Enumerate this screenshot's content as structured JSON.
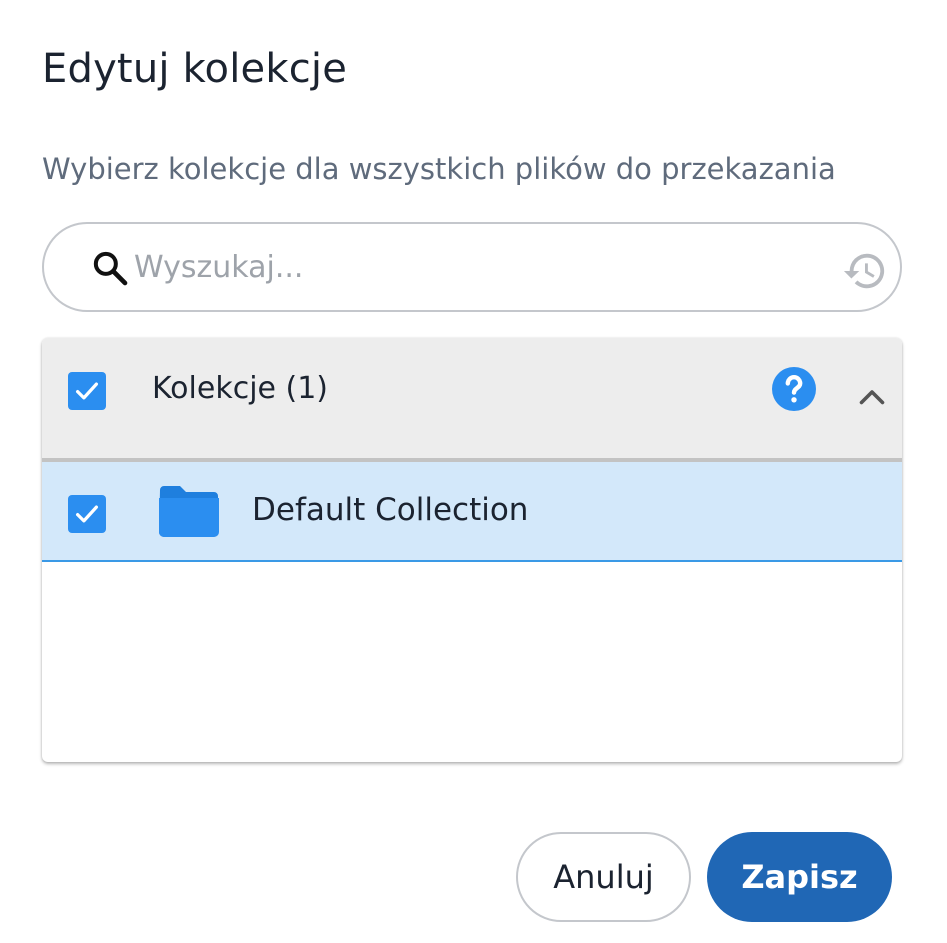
{
  "dialog": {
    "title": "Edytuj kolekcje",
    "subtitle": "Wybierz kolekcje dla wszystkich plików do przekazania"
  },
  "search": {
    "placeholder": "Wyszukaj...",
    "value": "",
    "icon": "search-icon",
    "history_icon": "history-icon"
  },
  "collections": {
    "header_label": "Kolekcje (1)",
    "header_checked": true,
    "help_icon": "help-icon",
    "expanded": true,
    "items": [
      {
        "label": "Default Collection",
        "checked": true,
        "icon": "folder-icon"
      }
    ]
  },
  "actions": {
    "cancel_label": "Anuluj",
    "save_label": "Zapisz"
  },
  "colors": {
    "accent": "#2b8ef0",
    "primary_button": "#2067b5",
    "selected_row": "#d3e8fa",
    "header_bg": "#ededed",
    "subtitle": "#5f6b7c"
  }
}
